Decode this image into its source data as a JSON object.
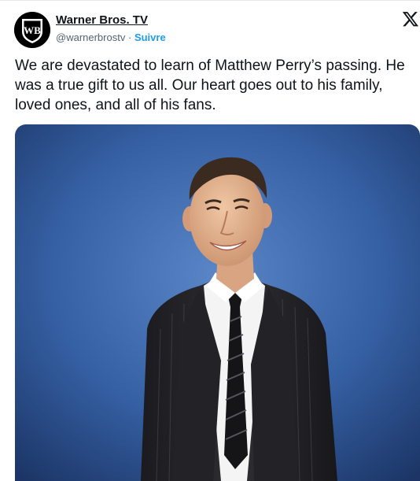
{
  "account": {
    "name": "Warner Bros. TV",
    "handle": "@warnerbrostv",
    "separator": "·",
    "follow_label": "Suivre",
    "avatar_letters": "WB"
  },
  "platform_icon": "x-logo-icon",
  "tweet": {
    "text": "We are devastated to learn of Matthew Perry’s passing. He was a true gift to us all. Our heart goes out to his family, loved ones, and all of his fans."
  },
  "media": {
    "subject": "portrait-photo",
    "background_color": "#3560a3",
    "suit_color": "#26262a",
    "shirt_color": "#f4f4f4"
  },
  "colors": {
    "text": "#0f1419",
    "secondary": "#536471",
    "accent": "#1d9bf0"
  }
}
